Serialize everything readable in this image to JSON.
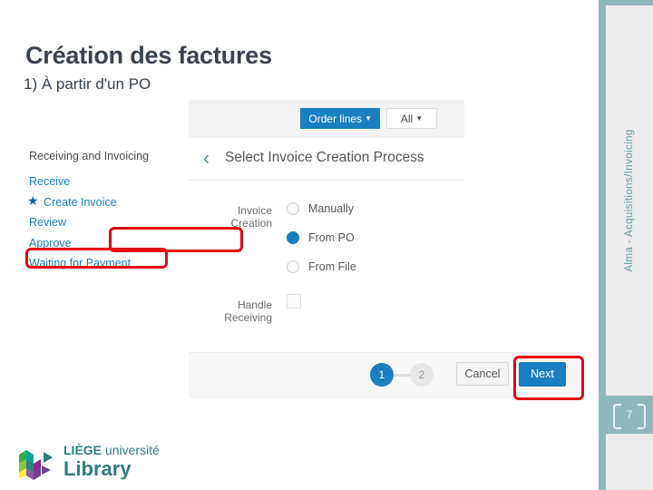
{
  "slide": {
    "title": "Création des factures",
    "subtitle": "1) À partir d'un PO",
    "page_number": "7",
    "side_label": "Alma - Acquisitions/Invoicing"
  },
  "nav": {
    "header": "Receiving and Invoicing",
    "items": [
      {
        "label": "Receive",
        "starred": false,
        "highlighted": false
      },
      {
        "label": "Create Invoice",
        "starred": true,
        "highlighted": true
      },
      {
        "label": "Review",
        "starred": false,
        "highlighted": false
      },
      {
        "label": "Approve",
        "starred": false,
        "highlighted": false
      },
      {
        "label": "Waiting for Payment",
        "starred": false,
        "highlighted": false
      }
    ]
  },
  "toolbar": {
    "order_lines_label": "Order lines",
    "all_label": "All",
    "caret": "▼"
  },
  "panel": {
    "back_chevron": "‹",
    "title": "Select Invoice Creation Process"
  },
  "form": {
    "invoice_creation_label": "Invoice Creation",
    "handle_receiving_label": "Handle Receiving",
    "options": [
      {
        "label": "Manually",
        "selected": false
      },
      {
        "label": "From PO",
        "selected": true
      },
      {
        "label": "From File",
        "selected": false
      }
    ],
    "handle_receiving_checked": false
  },
  "footer": {
    "step_current": "1",
    "step_next": "2",
    "cancel_label": "Cancel",
    "next_label": "Next"
  },
  "logo": {
    "line1_bold": "LIÈGE",
    "line1_rest": " université",
    "line2": "Library"
  },
  "colors": {
    "accent_blue": "#1a7fc1",
    "highlight_red": "#e30613",
    "teal": "#8fb8bb",
    "logo_teal": "#2e7d7f",
    "title_gray": "#3b4351"
  }
}
